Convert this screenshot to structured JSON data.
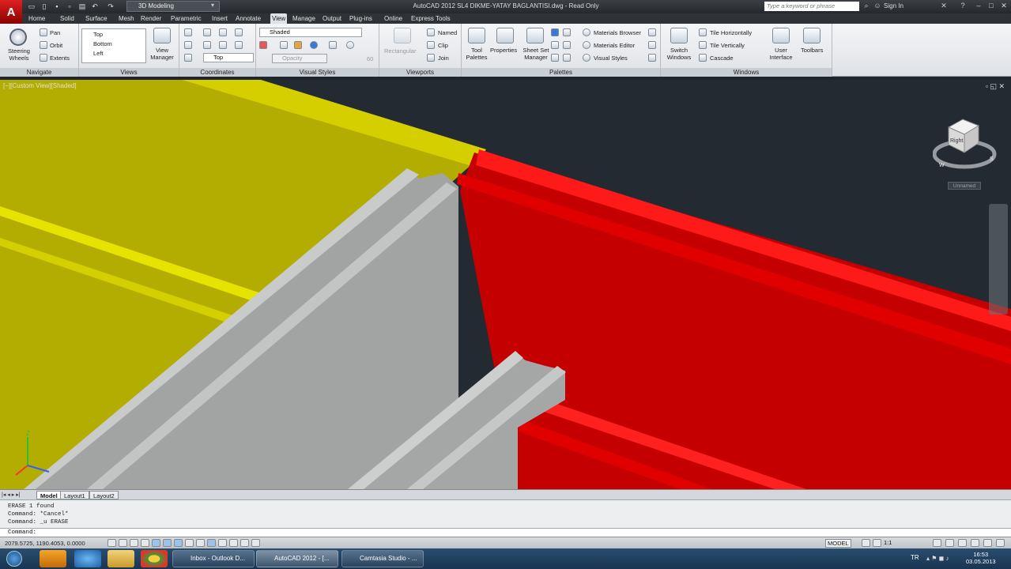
{
  "titlebar": {
    "logo": "A",
    "workspace": "3D Modeling",
    "title": "AutoCAD 2012    SL4 DIKME-YATAY BAGLANTISI.dwg - Read Only",
    "search_placeholder": "Type a keyword or phrase",
    "sign_in": "Sign In"
  },
  "tabs": [
    "Home",
    "Solid",
    "Surface",
    "Mesh",
    "Render",
    "Parametric",
    "Insert",
    "Annotate",
    "View",
    "Manage",
    "Output",
    "Plug-ins",
    "Online",
    "Express Tools"
  ],
  "ribbon": {
    "navigate": {
      "title": "Navigate",
      "steering": "Steering\nWheels",
      "pan": "Pan",
      "orbit": "Orbit",
      "extents": "Extents"
    },
    "views": {
      "title": "Views",
      "items": [
        "Top",
        "Bottom",
        "Left"
      ],
      "view_manager": "View\nManager"
    },
    "coordinates": {
      "title": "Coordinates",
      "ucs": "Top"
    },
    "visual_styles": {
      "title": "Visual Styles",
      "style": "Shaded",
      "opacity": "Opacity",
      "opacity_value": "60"
    },
    "viewports": {
      "title": "Viewports",
      "rectangular": "Rectangular",
      "named": "Named",
      "clip": "Clip",
      "join": "Join"
    },
    "palettes": {
      "title": "Palettes",
      "tool_palettes": "Tool\nPalettes",
      "properties": "Properties",
      "sheet_set": "Sheet Set\nManager",
      "materials_browser": "Materials Browser",
      "materials_editor": "Materials Editor",
      "visual_styles": "Visual Styles"
    },
    "windows": {
      "title": "Windows",
      "switch": "Switch\nWindows",
      "tile_h": "Tile Horizontally",
      "tile_v": "Tile Vertically",
      "cascade": "Cascade",
      "user_interface": "User\nInterface",
      "toolbars": "Toolbars"
    }
  },
  "viewport": {
    "label": "[−][Custom View][Shaded]",
    "viewcube_face": "Right",
    "compass_s": "S",
    "compass_w": "W",
    "ucs_name": "Unnamed",
    "axis_z": "Z"
  },
  "layout_tabs": [
    "Model",
    "Layout1",
    "Layout2"
  ],
  "command": {
    "history": [
      "ERASE 1 found",
      "Command: *Cancel*",
      "Command: _u ERASE"
    ],
    "prompt": "Command:"
  },
  "status": {
    "coords": "2079.5725, 1190.4053, 0.0000",
    "model": "MODEL",
    "scale": "1:1"
  },
  "taskbar": {
    "tasks": [
      "Inbox - Outlook D...",
      "AutoCAD 2012 - [...",
      "Camtasia Studio - ..."
    ],
    "lang": "TR",
    "time": "16:53",
    "date": "03.05.2013"
  },
  "colors": {
    "yellow_plate": "#b2ad00",
    "red_plate": "#c40000",
    "grey_profile": "#a2a4a3",
    "background": "#242a31"
  }
}
